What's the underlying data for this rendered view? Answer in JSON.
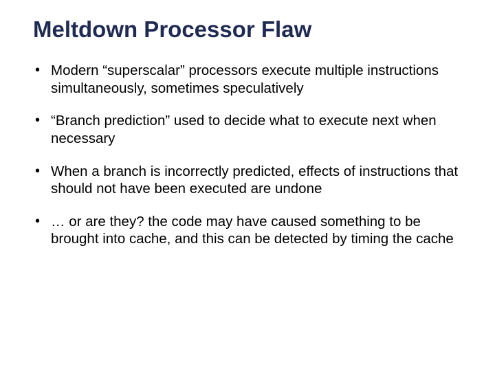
{
  "title": "Meltdown Processor Flaw",
  "bullets": [
    "Modern “superscalar” processors execute multiple instructions simultaneously, sometimes speculatively",
    "“Branch prediction” used to decide what to execute next when necessary",
    "When a branch is incorrectly predicted, effects of instructions that should not have been executed are undone",
    "… or are they?  the code may have caused something to be brought into cache, and this can be detected by timing the cache"
  ]
}
